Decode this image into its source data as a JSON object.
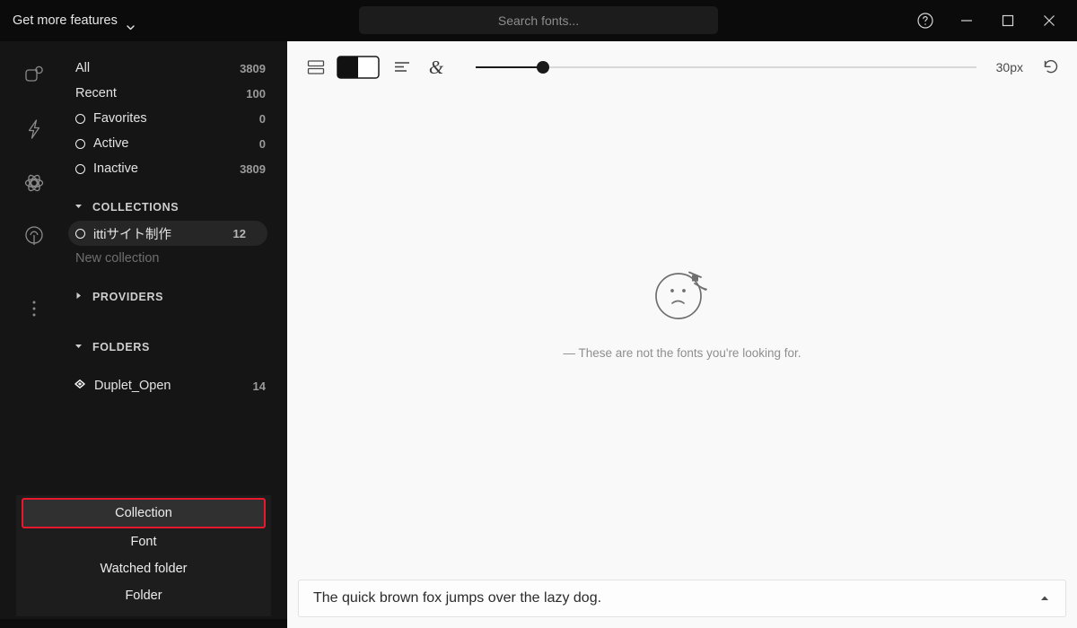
{
  "titlebar": {
    "get_more_features": "Get more features",
    "chevron_icon": "chevron-down-icon",
    "search_placeholder": "Search fonts...",
    "help_icon": "help-circle-icon",
    "minimize_icon": "minimize-icon",
    "maximize_icon": "maximize-icon",
    "close_icon": "close-icon"
  },
  "rail": {
    "items": [
      {
        "icon": "fonts-shape-icon",
        "name": "rail-item-fonts"
      },
      {
        "icon": "lightning-bolt-icon",
        "name": "rail-item-activate"
      },
      {
        "icon": "atom-icon",
        "name": "rail-item-playground"
      },
      {
        "icon": "broadcast-icon",
        "name": "rail-item-discover"
      },
      {
        "icon": "kebab-menu-icon",
        "name": "rail-item-more"
      }
    ]
  },
  "sidebar": {
    "filters": [
      {
        "label": "All",
        "count": "3809",
        "ring": false
      },
      {
        "label": "Recent",
        "count": "100",
        "ring": false
      },
      {
        "label": "Favorites",
        "count": "0",
        "ring": true
      },
      {
        "label": "Active",
        "count": "0",
        "ring": true
      },
      {
        "label": "Inactive",
        "count": "3809",
        "ring": true
      }
    ],
    "collections": {
      "header": "COLLECTIONS",
      "expanded": true,
      "items": [
        {
          "label": "ittiサイト制作",
          "count": "12",
          "selected": true
        }
      ],
      "new_collection": "New collection"
    },
    "providers": {
      "header": "PROVIDERS",
      "expanded": false
    },
    "folders": {
      "header": "FOLDERS",
      "expanded": true,
      "items": [
        {
          "label": "Duplet_Open",
          "count": "14",
          "icon": "diamond-icon"
        }
      ]
    }
  },
  "menu": {
    "highlight_color": "#e8192c",
    "items": [
      {
        "label": "Collection",
        "active": true
      },
      {
        "label": "Font",
        "active": false
      },
      {
        "label": "Watched folder",
        "active": false
      },
      {
        "label": "Folder",
        "active": false
      }
    ]
  },
  "toolbar": {
    "view_icon": "list-view-icon",
    "contrast_icon": "contrast-toggle-icon",
    "align_icon": "text-align-left-icon",
    "glyph_icon": "ampersand-glyph-icon",
    "slider_value_percent": 13.5,
    "size_label": "30px",
    "reset_icon": "reset-arrow-icon"
  },
  "empty_state": {
    "illustration": "sad-face-icon",
    "message": "— These are not the fonts you're looking for."
  },
  "preview": {
    "text": "The quick brown fox jumps over the lazy dog.",
    "caret_icon": "caret-up-icon"
  }
}
